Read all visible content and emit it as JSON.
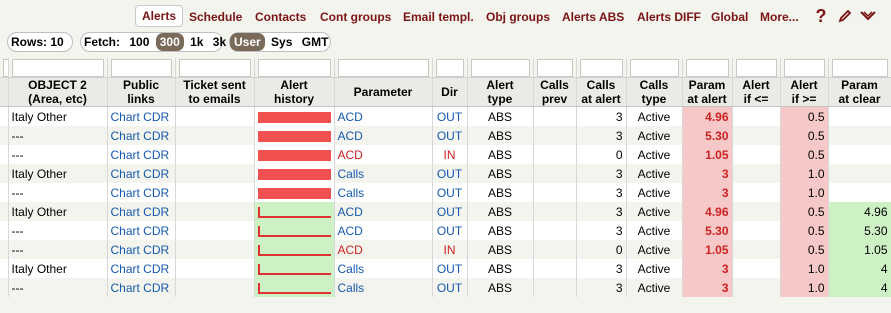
{
  "nav": {
    "items": [
      "Alerts",
      "Schedule",
      "Contacts",
      "Cont groups",
      "Email templ.",
      "Obj groups",
      "Alerts ABS",
      "Alerts DIFF",
      "Global",
      "More..."
    ],
    "active": "Alerts"
  },
  "icons": [
    "help-icon",
    "edit-icon",
    "collapse-icon"
  ],
  "controls": {
    "rows_label": "Rows: 10",
    "fetch_label": "Fetch:",
    "fetch_options": [
      "100",
      "300",
      "1k",
      "3k"
    ],
    "fetch_selected": "300",
    "time_options": [
      "User",
      "Sys",
      "GMT"
    ],
    "time_selected": "User"
  },
  "table": {
    "columns": [
      "OBJECT 2\n(Area, etc)",
      "Public\nlinks",
      "Ticket sent\nto emails",
      "Alert\nhistory",
      "Parameter",
      "Dir",
      "Alert\ntype",
      "Calls\nprev",
      "Calls\nat alert",
      "Calls\ntype",
      "Param\nat alert",
      "Alert\nif <=",
      "Alert\nif >=",
      "Param\nat clear"
    ],
    "rows": [
      {
        "object2": "Italy Other",
        "link": "Chart CDR",
        "ticket": "",
        "hist": "bar",
        "param": "ACD",
        "dir": "OUT",
        "atype": "ABS",
        "prev": "",
        "calls": "3",
        "ctype": "Active",
        "palert": "4.96",
        "if_le": "",
        "if_ge": "0.5",
        "pclear": ""
      },
      {
        "object2": "---",
        "link": "Chart CDR",
        "ticket": "",
        "hist": "bar",
        "param": "ACD",
        "dir": "OUT",
        "atype": "ABS",
        "prev": "",
        "calls": "3",
        "ctype": "Active",
        "palert": "5.30",
        "if_le": "",
        "if_ge": "0.5",
        "pclear": ""
      },
      {
        "object2": "---",
        "link": "Chart CDR",
        "ticket": "",
        "hist": "bar",
        "param": "ACD",
        "dir": "IN",
        "atype": "ABS",
        "prev": "",
        "calls": "0",
        "ctype": "Active",
        "palert": "1.05",
        "if_le": "",
        "if_ge": "0.5",
        "pclear": ""
      },
      {
        "object2": "Italy Other",
        "link": "Chart CDR",
        "ticket": "",
        "hist": "bar",
        "param": "Calls",
        "dir": "OUT",
        "atype": "ABS",
        "prev": "",
        "calls": "3",
        "ctype": "Active",
        "palert": "3",
        "if_le": "",
        "if_ge": "1.0",
        "pclear": ""
      },
      {
        "object2": "---",
        "link": "Chart CDR",
        "ticket": "",
        "hist": "bar",
        "param": "Calls",
        "dir": "OUT",
        "atype": "ABS",
        "prev": "",
        "calls": "3",
        "ctype": "Active",
        "palert": "3",
        "if_le": "",
        "if_ge": "1.0",
        "pclear": ""
      },
      {
        "object2": "Italy Other",
        "link": "Chart CDR",
        "ticket": "",
        "hist": "spark",
        "param": "ACD",
        "dir": "OUT",
        "atype": "ABS",
        "prev": "",
        "calls": "3",
        "ctype": "Active",
        "palert": "4.96",
        "if_le": "",
        "if_ge": "0.5",
        "pclear": "4.96"
      },
      {
        "object2": "---",
        "link": "Chart CDR",
        "ticket": "",
        "hist": "spark",
        "param": "ACD",
        "dir": "OUT",
        "atype": "ABS",
        "prev": "",
        "calls": "3",
        "ctype": "Active",
        "palert": "5.30",
        "if_le": "",
        "if_ge": "0.5",
        "pclear": "5.30"
      },
      {
        "object2": "---",
        "link": "Chart CDR",
        "ticket": "",
        "hist": "spark",
        "param": "ACD",
        "dir": "IN",
        "atype": "ABS",
        "prev": "",
        "calls": "0",
        "ctype": "Active",
        "palert": "1.05",
        "if_le": "",
        "if_ge": "0.5",
        "pclear": "1.05"
      },
      {
        "object2": "Italy Other",
        "link": "Chart CDR",
        "ticket": "",
        "hist": "spark",
        "param": "Calls",
        "dir": "OUT",
        "atype": "ABS",
        "prev": "",
        "calls": "3",
        "ctype": "Active",
        "palert": "3",
        "if_le": "",
        "if_ge": "1.0",
        "pclear": "4"
      },
      {
        "object2": "---",
        "link": "Chart CDR",
        "ticket": "",
        "hist": "spark",
        "param": "Calls",
        "dir": "OUT",
        "atype": "ABS",
        "prev": "",
        "calls": "3",
        "ctype": "Active",
        "palert": "3",
        "if_le": "",
        "if_ge": "1.0",
        "pclear": "4"
      }
    ]
  },
  "colors": {
    "accent": "#7a1414",
    "link": "#1559b0",
    "alert_red": "#cc2222",
    "alert_bg": "#f7c8c8",
    "clear_bg": "#cdf0c4",
    "bar_red": "#f05050"
  }
}
